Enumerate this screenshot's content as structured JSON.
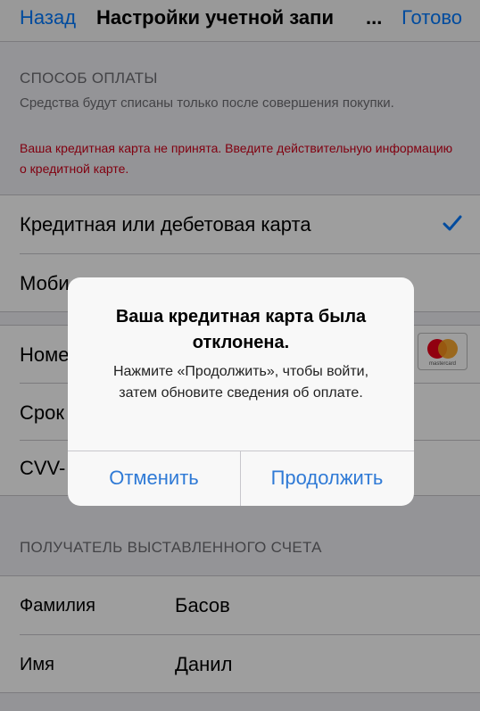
{
  "nav": {
    "back": "Назад",
    "title": "Настройки учетной запи",
    "ellipsis": "...",
    "done": "Готово"
  },
  "payment": {
    "header": "СПОСОБ ОПЛАТЫ",
    "desc": "Средства будут списаны только после совершения покупки.",
    "error": "Ваша кредитная карта не принята. Введите действительную информацию о кредитной карте.",
    "options": [
      {
        "label": "Кредитная или дебетовая карта",
        "selected": true
      },
      {
        "label": "Моби"
      }
    ]
  },
  "card_fields": {
    "number": "Номе",
    "expiry": "Срок",
    "cvv": "CVV-",
    "card_brand": "mastercard"
  },
  "billing": {
    "header": "ПОЛУЧАТЕЛЬ ВЫСТАВЛЕННОГО СЧЕТА",
    "rows": [
      {
        "label": "Фамилия",
        "value": "Басов"
      },
      {
        "label": "Имя",
        "value": "Данил"
      }
    ]
  },
  "alert": {
    "title": "Ваша кредитная карта была отклонена.",
    "message": "Нажмите «Продолжить», чтобы войти, затем обновите сведения об оплате.",
    "cancel": "Отменить",
    "continue": "Продолжить"
  },
  "colors": {
    "accent": "#007aff",
    "error": "#d0021b"
  }
}
